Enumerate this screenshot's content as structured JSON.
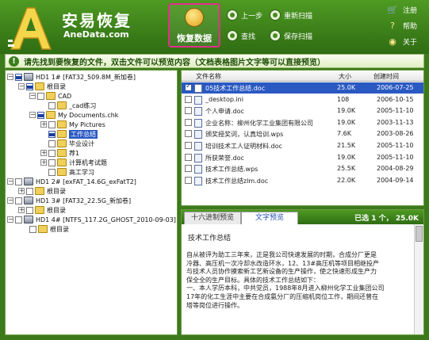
{
  "app": {
    "name": "安易恢复",
    "url": "AneData.com",
    "logo_letter": "A"
  },
  "toolbar": {
    "recover_label": "恢复数据",
    "prev_label": "上一步",
    "rescan_label": "重新扫描",
    "find_label": "查找",
    "save_scan_label": "保存扫描",
    "register_label": "注册",
    "help_label": "帮助",
    "about_label": "关于"
  },
  "hint": {
    "text": "请先找到要恢复的文件，双击文件可以预览内容（文档表格图片文字等可以直接预览）"
  },
  "tree": {
    "hd1_1": "HD1 1# [FAT32_509.8M_新加卷]",
    "root1": "根目录",
    "cad": "CAD",
    "cad_practice": "_cad练习",
    "mydocs": "My Documents.chk",
    "mypictures": "My Pictures",
    "worksummary": "工作总结",
    "graduation": "毕业设计",
    "folder_2": "荐1",
    "exam": "计算机考试题",
    "advanced_study": "高工学习",
    "hd1_2": "HD1 2# [exFAT_14.6G_exFatT2]",
    "root2": "根目录",
    "hd1_3": "HD1 3# [FAT32_22.5G_新加卷]",
    "root3": "根目录",
    "hd1_4": "HD1 4# [NTFS_117.2G_GHOST_2010-09-03]",
    "root4": "根目录"
  },
  "files": {
    "headers": {
      "name": "文件名称",
      "size": "大小",
      "created": "创建时间"
    },
    "rows": [
      {
        "name": "05技术工作总结.doc",
        "size": "25.0K",
        "date": "2006-07-25",
        "checked": true,
        "selected": true
      },
      {
        "name": "_desktop.ini",
        "size": "108",
        "date": "2006-10-15",
        "checked": false,
        "selected": false
      },
      {
        "name": "个人申请.doc",
        "size": "19.0K",
        "date": "2005-11-10",
        "checked": false,
        "selected": false
      },
      {
        "name": "企业名称：柳州化学工业集团有限公司",
        "size": "19.0K",
        "date": "2003-11-13",
        "checked": false,
        "selected": false
      },
      {
        "name": "颁奖授奖词，认真培训.wps",
        "size": "7.6K",
        "date": "2003-08-26",
        "checked": false,
        "selected": false
      },
      {
        "name": "培训技术工人证明材料.doc",
        "size": "21.5K",
        "date": "2005-11-10",
        "checked": false,
        "selected": false
      },
      {
        "name": "所获荣誉.doc",
        "size": "19.0K",
        "date": "2005-11-10",
        "checked": false,
        "selected": false
      },
      {
        "name": "技术工作总结.wps",
        "size": "25.5K",
        "date": "2004-08-29",
        "checked": false,
        "selected": false
      },
      {
        "name": "技术工作总结zlm.doc",
        "size": "22.0K",
        "date": "2004-09-14",
        "checked": false,
        "selected": false
      }
    ]
  },
  "preview": {
    "tab_hex": "十六进制预览",
    "tab_text": "文字预览",
    "status": "已选 1 个， 25.0K",
    "title": "技术工作总结",
    "lines": [
      "自从被评为助工三年来，正是我公司快速发展的时期，合成分厂更是",
      "冷器、高压机一次冷却水改造环水，12、13#高压机等项目相继投产",
      "与技术人员协作摸索新工艺新设备的生产操作，使之快速形成生产力",
      "保全全的生产目标。具体的技术工作总结如下：",
      "一、本人学历本科，中共党员，1988年8月进入柳州化学工业集团公司",
      "17年的化工生涯中主要在合成氨分厂的压缩机岗位工作，期间还曾在",
      "塔等岗位进行操作。"
    ]
  },
  "colors": {
    "brand_green": "#3c7a1c",
    "highlight_pink": "#e0308a",
    "selection_blue": "#2a59c2"
  }
}
